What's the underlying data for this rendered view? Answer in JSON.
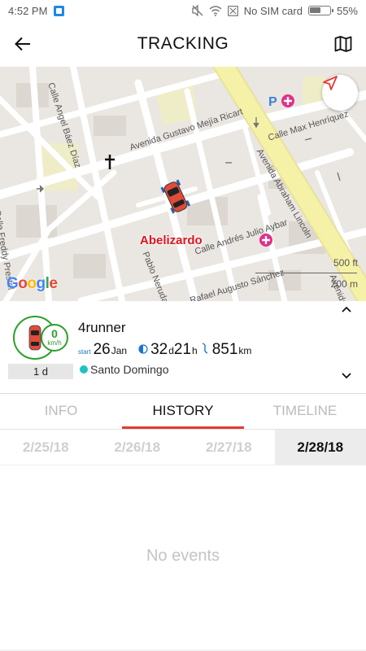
{
  "status_bar": {
    "time": "4:52 PM",
    "carrier": "No SIM card",
    "battery": "55%"
  },
  "app_bar": {
    "title": "TRACKING",
    "back_icon": "arrow-left-icon",
    "map_icon": "folded-map-icon"
  },
  "map": {
    "streets": [
      "Calle Angel Báez Díaz",
      "Avenida Gustavo Mejía Ricart",
      "Calle Max Henríquez",
      "Avenida Abraham Lincoln",
      "Calle Freddy Prestol",
      "Calle Andrés Julio Aybar",
      "Pablo Neruda",
      "Rafael Augusto Sánchez",
      "Avenida"
    ],
    "place_label": "Abelizardo",
    "attribution": "Google",
    "scale_ft": "500 ft",
    "scale_m": "200 m",
    "locate_icon": "navigation-arrow-icon"
  },
  "vehicle": {
    "name": "4runner",
    "speed_value": "0",
    "speed_unit": "km/h",
    "days_label": "1 d",
    "start_label": "start",
    "start_day": "26",
    "start_month": "Jan",
    "duration_days": "32",
    "duration_days_unit": "d",
    "duration_hours": "21",
    "duration_hours_unit": "h",
    "distance": "851",
    "distance_unit": "km",
    "location": "Santo Domingo",
    "collapse_icon": "chevron-up-icon",
    "expand_icon": "chevron-down-icon"
  },
  "tabs": [
    {
      "label": "INFO",
      "active": false
    },
    {
      "label": "HISTORY",
      "active": true
    },
    {
      "label": "TIMELINE",
      "active": false
    }
  ],
  "dates": [
    "2/25/18",
    "2/26/18",
    "2/27/18",
    "2/28/18"
  ],
  "selected_date": "2/28/18",
  "empty_message": "No events",
  "colors": {
    "accent_red": "#e53935",
    "speed_green": "#2aa02a",
    "location_dot": "#1ec2c2",
    "road_yellow": "#f3f09a"
  }
}
